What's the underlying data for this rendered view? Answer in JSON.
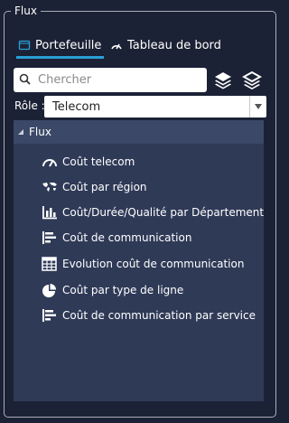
{
  "panel": {
    "title": "Flux"
  },
  "tabs": [
    {
      "label": "Portefeuille",
      "icon": "folder-icon",
      "active": true
    },
    {
      "label": "Tableau de bord",
      "icon": "gauge-icon",
      "active": false
    }
  ],
  "search": {
    "placeholder": "Chercher",
    "value": ""
  },
  "toolbar": {
    "buttons": [
      "layers-expand-icon",
      "layers-collapse-icon"
    ]
  },
  "role": {
    "label": "Rôle :",
    "selected": "Telecom"
  },
  "tree": {
    "root_label": "Flux",
    "items": [
      {
        "label": "Coût telecom",
        "icon": "gauge-icon"
      },
      {
        "label": "Coût par région",
        "icon": "world-map-icon"
      },
      {
        "label": "Coût/Durée/Qualité par Département",
        "icon": "bar-chart-icon"
      },
      {
        "label": "Coût de communication",
        "icon": "horizontal-bar-chart-icon"
      },
      {
        "label": "Evolution coût de communication",
        "icon": "table-icon"
      },
      {
        "label": "Coût par type de ligne",
        "icon": "pie-chart-icon"
      },
      {
        "label": "Coût de communication par service",
        "icon": "horizontal-bar-chart-icon"
      }
    ]
  },
  "colors": {
    "background": "#1c2235",
    "accent": "#2a9fd6",
    "tree_bg": "#2f3a57",
    "tree_header_bg": "#3b4867"
  }
}
